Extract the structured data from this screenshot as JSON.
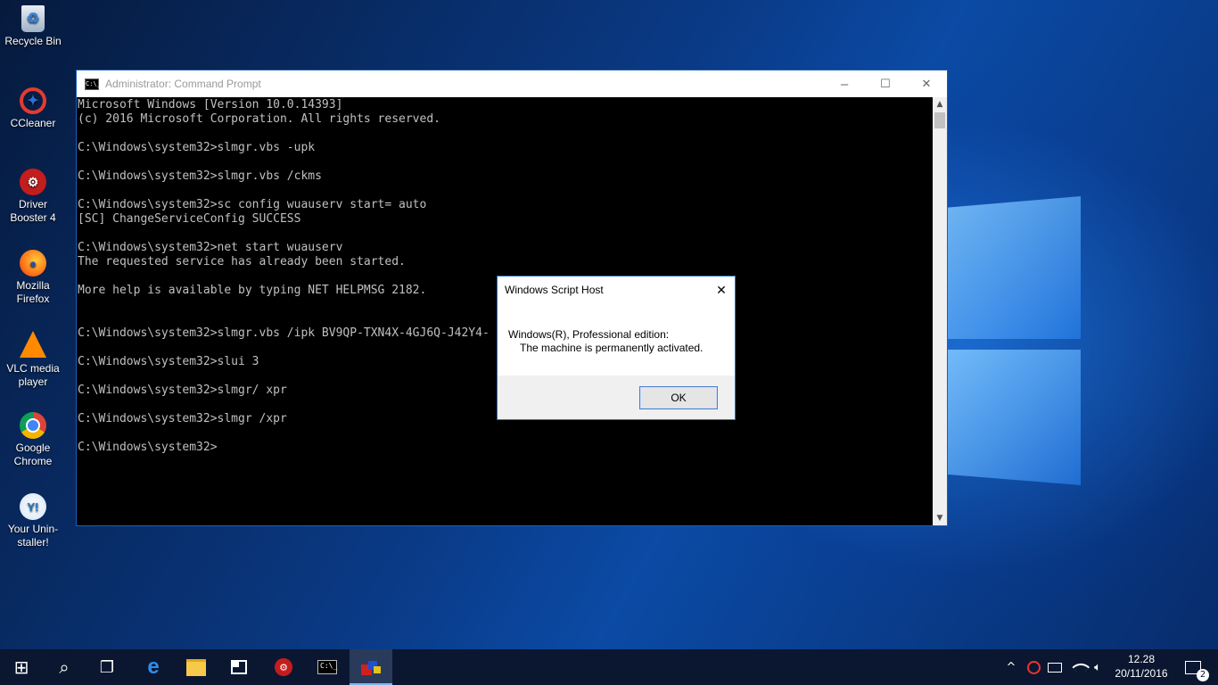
{
  "desktop": {
    "icons": [
      {
        "label": "Recycle Bin",
        "icon": "recycle-bin-icon"
      },
      {
        "label": "CCleaner",
        "icon": "ccleaner-icon"
      },
      {
        "label": "Driver Booster 4",
        "icon": "driver-booster-icon"
      },
      {
        "label": "Mozilla Firefox",
        "icon": "firefox-icon"
      },
      {
        "label": "VLC media player",
        "icon": "vlc-icon"
      },
      {
        "label": "Google Chrome",
        "icon": "chrome-icon"
      },
      {
        "label": "Your Unin-staller!",
        "icon": "your-uninstaller-icon"
      }
    ]
  },
  "cmd": {
    "title": "Administrator: Command Prompt",
    "icon_glyph": "C:\\_",
    "lines": [
      "Microsoft Windows [Version 10.0.14393]",
      "(c) 2016 Microsoft Corporation. All rights reserved.",
      "",
      "C:\\Windows\\system32>slmgr.vbs -upk",
      "",
      "C:\\Windows\\system32>slmgr.vbs /ckms",
      "",
      "C:\\Windows\\system32>sc config wuauserv start= auto",
      "[SC] ChangeServiceConfig SUCCESS",
      "",
      "C:\\Windows\\system32>net start wuauserv",
      "The requested service has already been started.",
      "",
      "More help is available by typing NET HELPMSG 2182.",
      "",
      "",
      "C:\\Windows\\system32>slmgr.vbs /ipk BV9QP-TXN4X-4GJ6Q-J42Y4-",
      "",
      "C:\\Windows\\system32>slui 3",
      "",
      "C:\\Windows\\system32>slmgr/ xpr",
      "",
      "C:\\Windows\\system32>slmgr /xpr",
      "",
      "C:\\Windows\\system32>"
    ],
    "minimize": "–",
    "maximize": "☐",
    "close": "✕",
    "scroll_up": "▲",
    "scroll_down": "▼"
  },
  "dialog": {
    "title": "Windows Script Host",
    "line1": "Windows(R), Professional edition:",
    "line2": "The machine is permanently activated.",
    "ok": "OK",
    "close": "✕"
  },
  "taskbar": {
    "start": "⊞",
    "search": "⌕",
    "task_view": "❐",
    "clock_time": "12.28",
    "clock_date": "20/11/2016",
    "notification_count": "2",
    "tray_chevron": "^"
  },
  "colors": {
    "cmd_bg": "#000000",
    "cmd_text": "#c0c0c0",
    "taskbar_bg": "#0b1730",
    "accent": "#76b9ed"
  }
}
